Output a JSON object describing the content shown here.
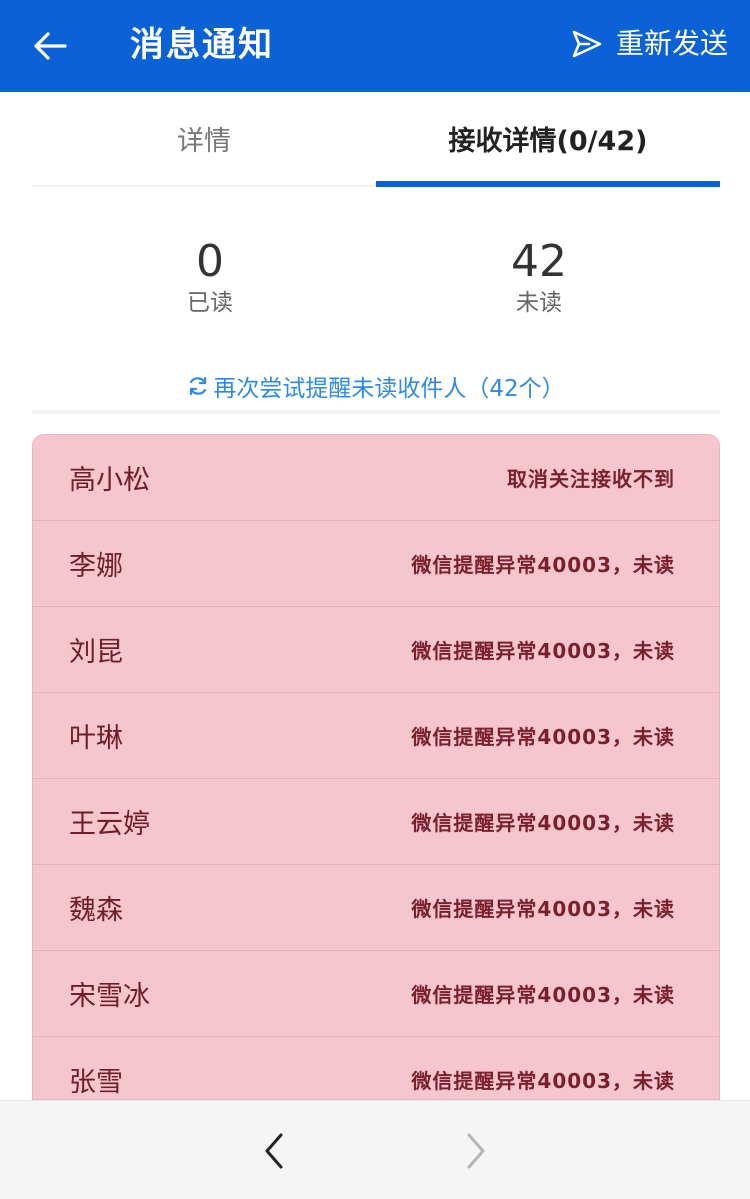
{
  "header": {
    "title": "消息通知",
    "resend_label": "重新发送",
    "back_icon": "arrow-left-icon",
    "send_icon": "paper-plane-icon"
  },
  "tabs": [
    {
      "label": "详情",
      "active": false
    },
    {
      "label": "接收详情(0/42)",
      "active": true
    }
  ],
  "stats": {
    "read_count": "0",
    "read_label": "已读",
    "unread_count": "42",
    "unread_label": "未读"
  },
  "retry": {
    "label": "再次尝试提醒未读收件人（42个）",
    "icon": "refresh-icon"
  },
  "recipients": [
    {
      "name": "高小松",
      "status": "取消关注接收不到"
    },
    {
      "name": "李娜",
      "status": "微信提醒异常40003，未读"
    },
    {
      "name": "刘昆",
      "status": "微信提醒异常40003，未读"
    },
    {
      "name": "叶琳",
      "status": "微信提醒异常40003，未读"
    },
    {
      "name": "王云婷",
      "status": "微信提醒异常40003，未读"
    },
    {
      "name": "魏森",
      "status": "微信提醒异常40003，未读"
    },
    {
      "name": "宋雪冰",
      "status": "微信提醒异常40003，未读"
    },
    {
      "name": "张雪",
      "status": "微信提醒异常40003，未读"
    }
  ],
  "footer": {
    "prev_icon": "chevron-left-icon",
    "next_icon": "chevron-right-icon"
  },
  "colors": {
    "primary": "#0b62d6",
    "link": "#2e8ae6",
    "row_bg": "#f5c6cd",
    "row_text": "#7a1f2d"
  }
}
